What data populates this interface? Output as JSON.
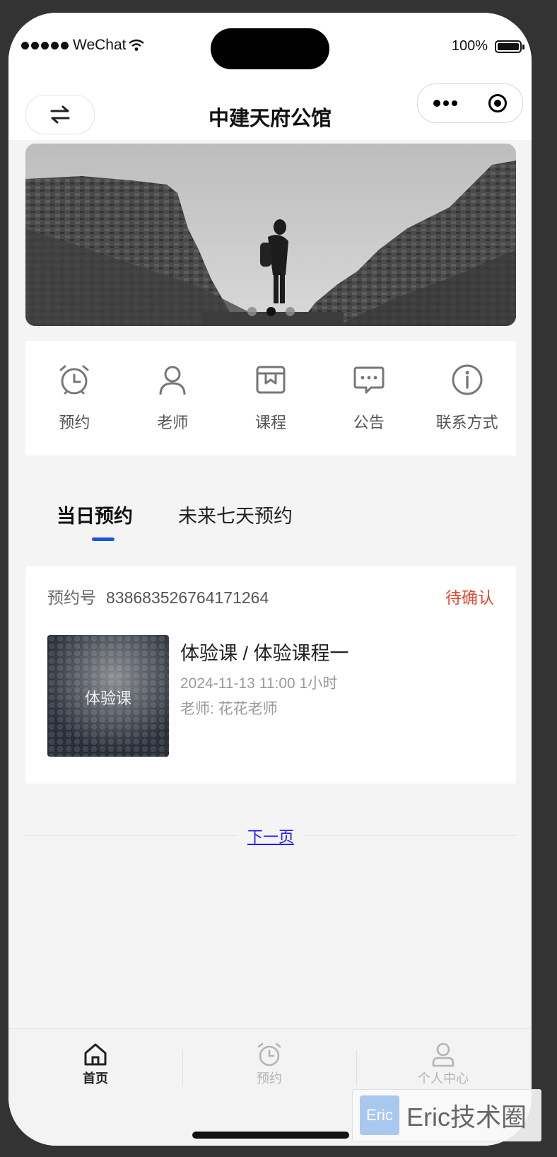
{
  "status_bar": {
    "carrier": "WeChat",
    "battery": "100%"
  },
  "nav": {
    "title": "中建天府公馆"
  },
  "banner": {
    "dots": 3,
    "active_index": 1
  },
  "quick_menu": [
    {
      "label": "预约",
      "icon": "alarm-clock-icon"
    },
    {
      "label": "老师",
      "icon": "user-icon"
    },
    {
      "label": "课程",
      "icon": "course-box-icon"
    },
    {
      "label": "公告",
      "icon": "message-icon"
    },
    {
      "label": "联系方式",
      "icon": "info-icon"
    }
  ],
  "tabs": [
    {
      "label": "当日预约",
      "active": true
    },
    {
      "label": "未来七天预约",
      "active": false
    }
  ],
  "booking": {
    "number_label": "预约号",
    "number": "838683526764171264",
    "status": "待确认",
    "thumb_label": "体验课",
    "title": "体验课 / 体验课程一",
    "time": "2024-11-13 11:00 1小时",
    "teacher": "老师: 花花老师"
  },
  "pager": {
    "next": "下一页"
  },
  "tabbar": [
    {
      "label": "首页",
      "icon": "home-icon",
      "active": true
    },
    {
      "label": "预约",
      "icon": "alarm-clock-icon",
      "active": false
    },
    {
      "label": "个人中心",
      "icon": "user-icon",
      "active": false
    }
  ],
  "watermark": {
    "logo": "Eric",
    "text": "Eric技术圈"
  },
  "colors": {
    "accent": "#1a56db",
    "status_pending": "#e5482d",
    "link": "#1a1aff"
  }
}
